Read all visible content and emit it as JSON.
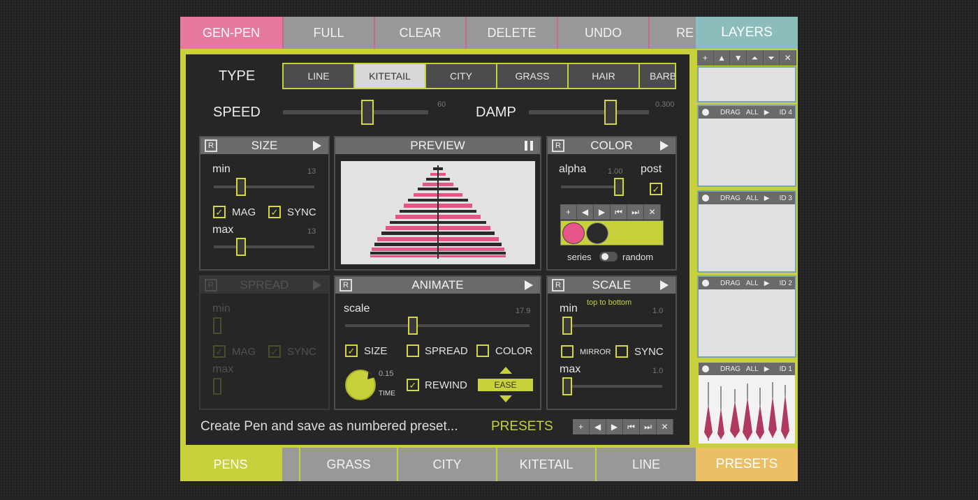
{
  "topbar": {
    "logo": "GEN-PEN",
    "buttons": [
      "FULL",
      "CLEAR",
      "DELETE",
      "UNDO",
      "RE"
    ],
    "layers_title": "LAYERS"
  },
  "type": {
    "label": "TYPE",
    "tabs": [
      "LINE",
      "KITETAIL",
      "CITY",
      "GRASS",
      "HAIR",
      "BARB"
    ],
    "selected": "KITETAIL"
  },
  "speed": {
    "label": "SPEED",
    "value": "60",
    "level": 0.58
  },
  "damp": {
    "label": "DAMP",
    "value": "0.300",
    "level": 0.7
  },
  "size_panel": {
    "title": "SIZE",
    "r": "R",
    "min_label": "min",
    "min_value": "13",
    "max_label": "max",
    "max_value": "13",
    "mag": "MAG",
    "sync": "SYNC"
  },
  "preview_panel": {
    "title": "PREVIEW"
  },
  "color_panel": {
    "title": "COLOR",
    "r": "R",
    "alpha_label": "alpha",
    "alpha_value": "1.00",
    "post_label": "post",
    "series_label": "series",
    "random_label": "random",
    "swatches": [
      "#e5558a",
      "#2a2a2a"
    ],
    "palette_bg": "#c8d03c"
  },
  "spread_panel": {
    "title": "SPREAD",
    "r": "R",
    "min_label": "min",
    "max_label": "max",
    "mag": "MAG",
    "sync": "SYNC"
  },
  "animate_panel": {
    "title": "ANIMATE",
    "r": "R",
    "scale_label": "scale",
    "scale_value": "17.9",
    "size": "SIZE",
    "spread": "SPREAD",
    "color": "COLOR",
    "time_value": "0.15",
    "time_label": "TIME",
    "rewind": "REWIND",
    "ease": "EASE"
  },
  "scale_panel": {
    "title": "SCALE",
    "r": "R",
    "min_label": "min",
    "min_value": "1.0",
    "hint": "top to bottom",
    "mirror": "MIRROR",
    "sync": "SYNC",
    "max_label": "max",
    "max_value": "1.0"
  },
  "footer": {
    "create_text": "Create Pen and save as numbered preset...",
    "presets_link": "PRESETS"
  },
  "mini_toolbar": [
    "+",
    "◀",
    "▶",
    "⏮",
    "⏭",
    "✕"
  ],
  "layers": {
    "toolbar": [
      "+",
      "▲",
      "▼",
      "⏶",
      "⏷",
      "✕"
    ],
    "items": [
      {
        "drag": "DRAG",
        "all": "ALL",
        "id": "ID 4"
      },
      {
        "drag": "DRAG",
        "all": "ALL",
        "id": "ID 3"
      },
      {
        "drag": "DRAG",
        "all": "ALL",
        "id": "ID 2"
      },
      {
        "drag": "DRAG",
        "all": "ALL",
        "id": "ID 1"
      }
    ]
  },
  "bottombar": {
    "pens": "PENS",
    "items": [
      "GRASS",
      "CITY",
      "KITETAIL",
      "LINE"
    ],
    "presets": "PRESETS"
  },
  "colors": {
    "accent": "#c8d03c",
    "pink": "#e57a9c",
    "teal": "#8cbcbc",
    "orange": "#ebbf66"
  }
}
